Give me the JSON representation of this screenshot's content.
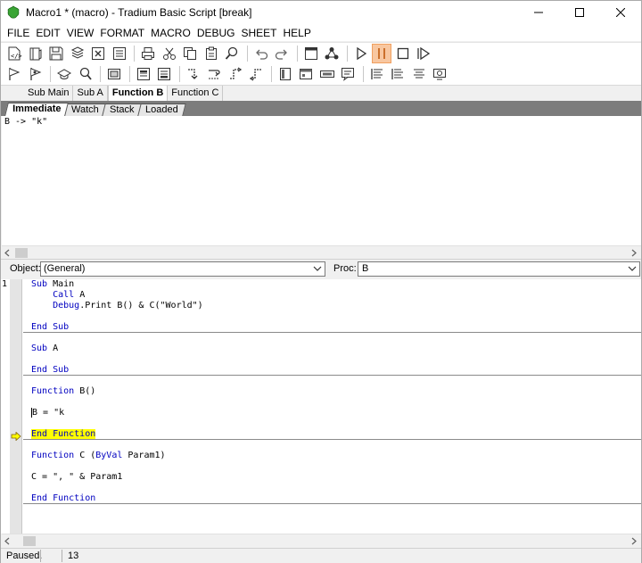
{
  "window": {
    "title": "Macro1 * (macro) - Tradium Basic Script [break]"
  },
  "menu": [
    "FILE",
    "EDIT",
    "VIEW",
    "FORMAT",
    "MACRO",
    "DEBUG",
    "SHEET",
    "HELP"
  ],
  "toolbar_row1_icons": [
    "new-macro-icon",
    "open-icon",
    "save-icon",
    "save-all-icon",
    "close-icon",
    "properties-icon",
    "print-icon",
    "cut-icon",
    "copy-icon",
    "paste-icon",
    "find-icon",
    "undo-icon",
    "redo-icon",
    "dialog-editor-icon",
    "references-icon",
    "run-icon",
    "pause-icon",
    "stop-icon",
    "step-icon"
  ],
  "toolbar_row2_icons": [
    "breakpoint-icon",
    "toggle-breakpoint-icon",
    "quick-watch-icon",
    "add-watch-icon",
    "call-stack-icon",
    "step-into-icon",
    "step-over-icon",
    "step-out-icon",
    "run-to-cursor-icon",
    "set-next-icon",
    "show-next-icon",
    "userdialog-icon",
    "edit-dialog-icon",
    "edit-box-icon",
    "comment-icon",
    "indent-icon",
    "outdent-icon",
    "align-icon",
    "object-browser-icon"
  ],
  "proc_tabs": [
    "Sub Main",
    "Sub A",
    "Function B",
    "Function C"
  ],
  "proc_tabs_active": "Function B",
  "debug_tabs": [
    "Immediate",
    "Watch",
    "Stack",
    "Loaded"
  ],
  "debug_tabs_active": "Immediate",
  "immediate": {
    "output": "B -> \"k\""
  },
  "object_selector": {
    "label": "Object:",
    "value": "(General)"
  },
  "proc_selector": {
    "label": "Proc:",
    "value": "B"
  },
  "editor": {
    "line_number": "1",
    "blocks": [
      {
        "lines": [
          {
            "kw": "Sub",
            "rest": " Main"
          },
          {
            "indent": "    ",
            "kw": "Call",
            "rest": " A"
          },
          {
            "indent": "    ",
            "kw": "Debug",
            "rest": ".Print B() & C(\"World\")"
          },
          {
            "text": ""
          },
          {
            "kw": "End Sub",
            "rest": ""
          }
        ]
      },
      {
        "lines": [
          {
            "kw": "Sub",
            "rest": " A"
          },
          {
            "text": ""
          },
          {
            "kw": "End Sub",
            "rest": ""
          }
        ]
      },
      {
        "lines": [
          {
            "kw": "Function",
            "rest": " B()"
          },
          {
            "text": ""
          },
          {
            "text": "B = \"k"
          },
          {
            "text": ""
          },
          {
            "kw": "End Function",
            "rest": "",
            "current": true
          }
        ]
      },
      {
        "lines": [
          {
            "kw": "Function",
            "rest": " C (",
            "kw2": "ByVal",
            "rest2": " Param1)"
          },
          {
            "text": ""
          },
          {
            "text": "C = \", \" & Param1"
          },
          {
            "text": ""
          },
          {
            "kw": "End Function",
            "rest": ""
          }
        ]
      }
    ]
  },
  "status": {
    "state": "Paused.",
    "line": "13"
  },
  "colors": {
    "keyword": "#0000c0",
    "current_line_highlight": "#ffff00",
    "active_toolbar_button": "#f8c7a0"
  }
}
